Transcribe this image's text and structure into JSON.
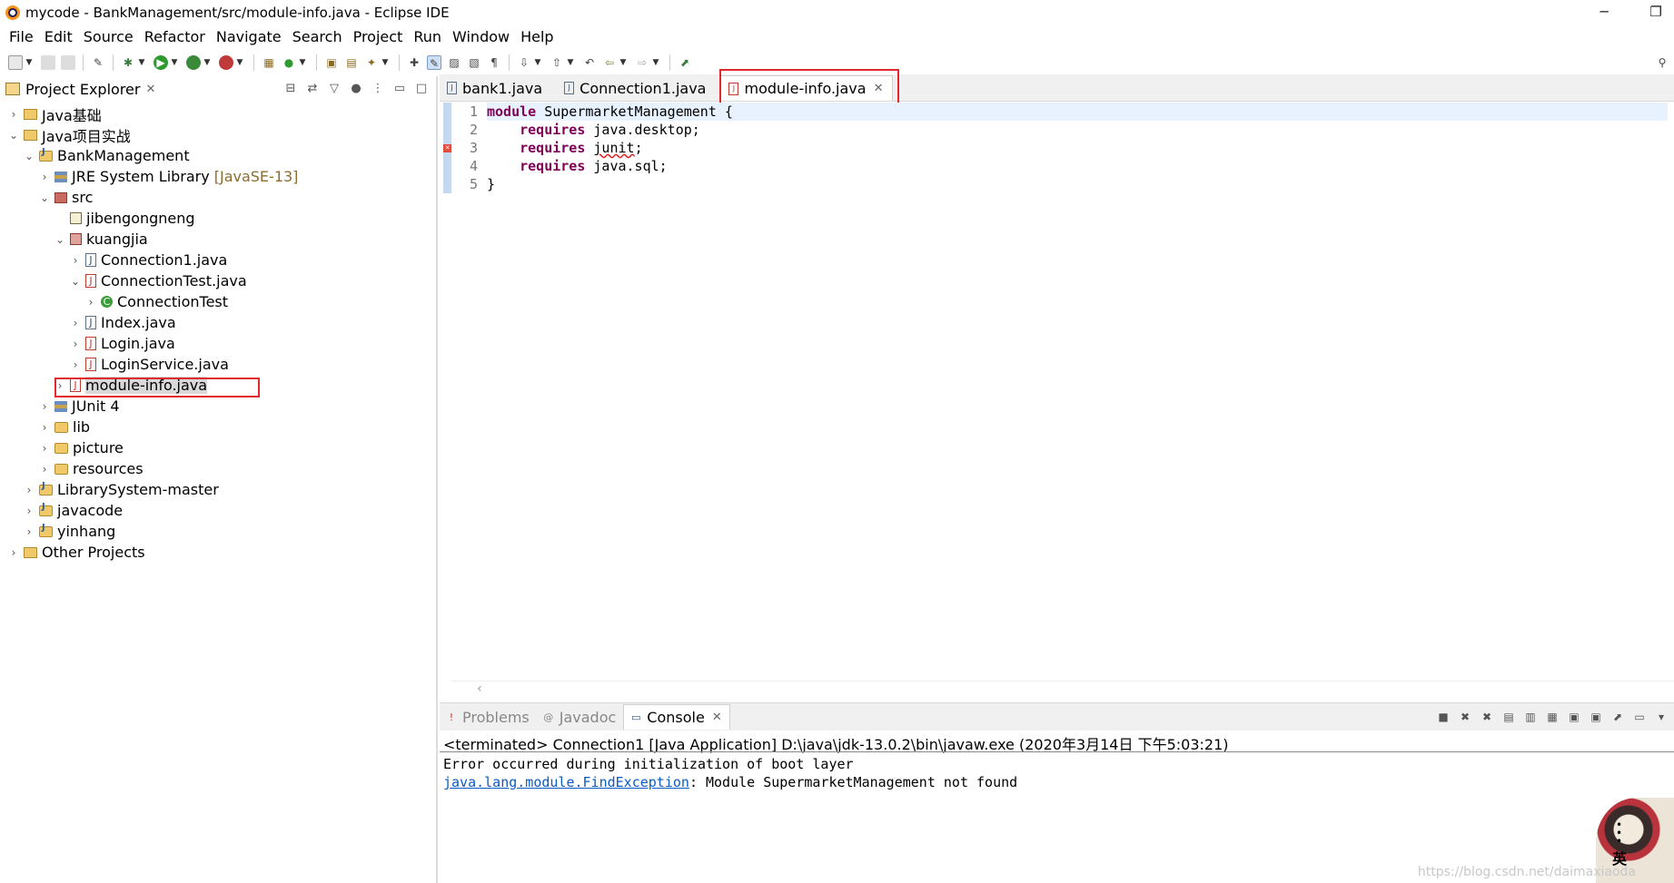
{
  "window": {
    "title": "mycode - BankManagement/src/module-info.java - Eclipse IDE",
    "minimize": "─",
    "restore": "❐"
  },
  "menu": [
    "File",
    "Edit",
    "Source",
    "Refactor",
    "Navigate",
    "Search",
    "Project",
    "Run",
    "Window",
    "Help"
  ],
  "explorer": {
    "title": "Project Explorer",
    "close": "✕",
    "tree": [
      {
        "label": "Java基础",
        "depth": 0,
        "twisty": "›",
        "icon": "other"
      },
      {
        "label": "Java项目实战",
        "depth": 0,
        "twisty": "⌄",
        "icon": "other"
      },
      {
        "label": "BankManagement",
        "depth": 1,
        "twisty": "⌄",
        "icon": "project"
      },
      {
        "label": "JRE System Library",
        "decor": "[JavaSE-13]",
        "depth": 2,
        "twisty": "›",
        "icon": "lib"
      },
      {
        "label": "src",
        "depth": 2,
        "twisty": "⌄",
        "icon": "pkgroot"
      },
      {
        "label": "jibengongneng",
        "depth": 3,
        "twisty": "",
        "icon": "pkg"
      },
      {
        "label": "kuangjia",
        "depth": 3,
        "twisty": "⌄",
        "icon": "pkgerr"
      },
      {
        "label": "Connection1.java",
        "depth": 4,
        "twisty": "›",
        "icon": "java"
      },
      {
        "label": "ConnectionTest.java",
        "depth": 4,
        "twisty": "⌄",
        "icon": "javaerr"
      },
      {
        "label": "ConnectionTest",
        "depth": 5,
        "twisty": "›",
        "icon": "class"
      },
      {
        "label": "Index.java",
        "depth": 4,
        "twisty": "›",
        "icon": "java"
      },
      {
        "label": "Login.java",
        "depth": 4,
        "twisty": "›",
        "icon": "javaerr"
      },
      {
        "label": "LoginService.java",
        "depth": 4,
        "twisty": "›",
        "icon": "javaerr"
      },
      {
        "label": "module-info.java",
        "depth": 3,
        "twisty": "›",
        "icon": "javaerr",
        "selected": true
      },
      {
        "label": "JUnit 4",
        "depth": 2,
        "twisty": "›",
        "icon": "lib"
      },
      {
        "label": "lib",
        "depth": 2,
        "twisty": "›",
        "icon": "openfolder"
      },
      {
        "label": "picture",
        "depth": 2,
        "twisty": "›",
        "icon": "openfolder"
      },
      {
        "label": "resources",
        "depth": 2,
        "twisty": "›",
        "icon": "openfolder"
      },
      {
        "label": "LibrarySystem-master",
        "depth": 1,
        "twisty": "›",
        "icon": "project"
      },
      {
        "label": "javacode",
        "depth": 1,
        "twisty": "›",
        "icon": "project"
      },
      {
        "label": "yinhang",
        "depth": 1,
        "twisty": "›",
        "icon": "project"
      },
      {
        "label": "Other Projects",
        "depth": 0,
        "twisty": "›",
        "icon": "other"
      }
    ]
  },
  "editor": {
    "tabs": [
      {
        "label": "bank1.java",
        "active": false
      },
      {
        "label": "Connection1.java",
        "active": false
      },
      {
        "label": "module-info.java",
        "active": true
      }
    ],
    "tab_close": "✕",
    "line_numbers": [
      "1",
      "2",
      "3",
      "4",
      "5"
    ],
    "code": {
      "l1_kw": "module",
      "l1_rest": " SupermarketManagement {",
      "l2_indent": "    ",
      "l2_kw": "requires",
      "l2_rest": " java.desktop;",
      "l3_indent": "    ",
      "l3_kw": "requires",
      "l3_sp": " ",
      "l3_err": "junit",
      "l3_rest": ";",
      "l4_indent": "    ",
      "l4_kw": "requires",
      "l4_rest": " java.sql;",
      "l5": "}"
    },
    "scroll_left": "‹"
  },
  "console": {
    "tabs": [
      {
        "label": "Problems",
        "icon": "!",
        "active": false
      },
      {
        "label": "Javadoc",
        "icon": "@",
        "active": false
      },
      {
        "label": "Console",
        "icon": "▭",
        "active": true
      }
    ],
    "tab_close": "✕",
    "status": "<terminated> Connection1 [Java Application] D:\\java\\jdk-13.0.2\\bin\\javaw.exe (2020年3月14日 下午5:03:21)",
    "line1": "Error occurred during initialization of boot layer",
    "line2_link": "java.lang.module.FindException",
    "line2_rest": ": Module SupermarketManagement not found"
  },
  "overlay": {
    "watermark": "https://blog.csdn.net/daimaxiaoda",
    "ime": "英"
  },
  "colors": {
    "keyword": "#7f0055",
    "link": "#0a5bc4",
    "highlight_box": "#e0282d"
  }
}
